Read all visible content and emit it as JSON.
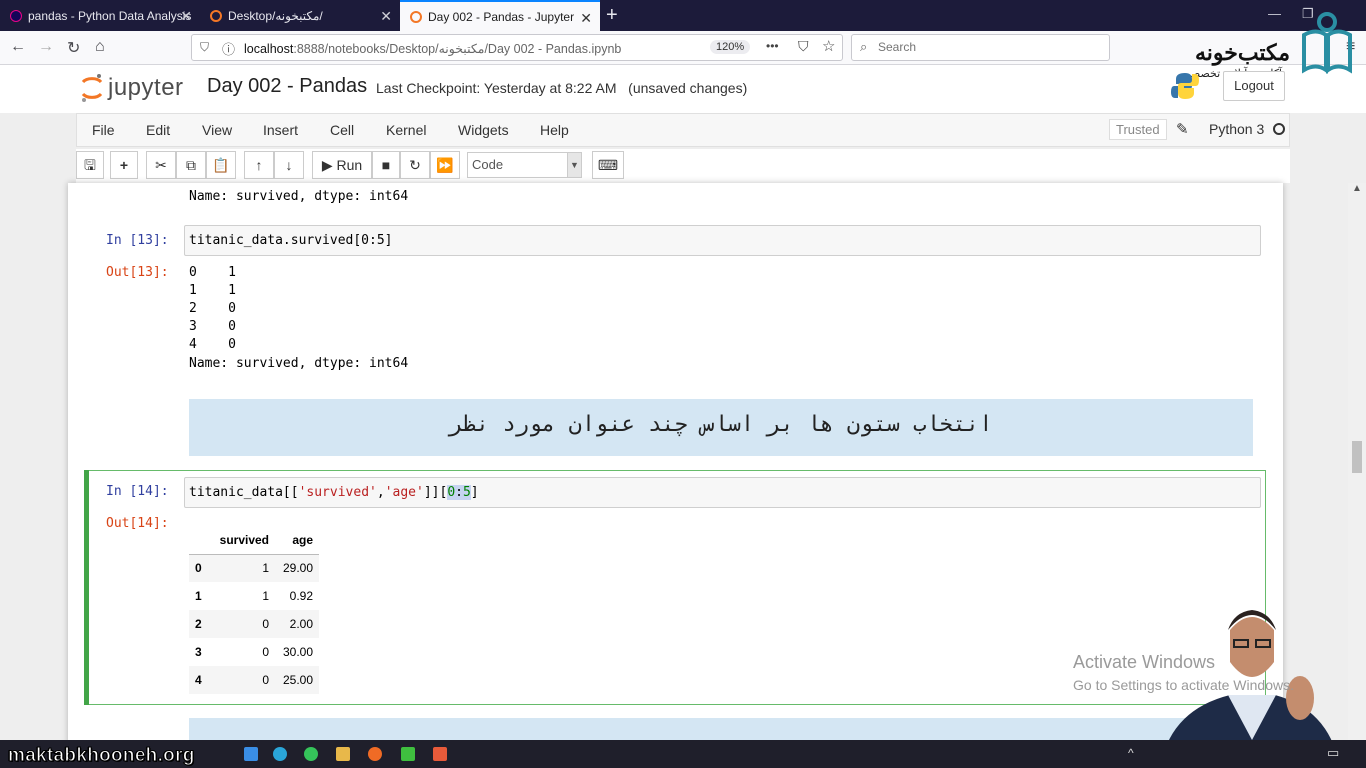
{
  "browser": {
    "tabs": [
      {
        "title": "pandas - Python Data Analysis"
      },
      {
        "title": "Desktop/مکتبخونه/"
      },
      {
        "title": "Day 002 - Pandas - Jupyter Not"
      }
    ],
    "url_host": "localhost",
    "url_path": ":8888/notebooks/Desktop/مکتبخونه/Day 002 - Pandas.ipynb",
    "zoom": "120%",
    "search_placeholder": "Search",
    "more_label": "•••"
  },
  "brand": {
    "name": "مکتب‌خونه",
    "tagline": "آکادمی آنلاین تخصصی ها"
  },
  "jupyter": {
    "logo": "jupyter",
    "title": "Day 002 - Pandas",
    "checkpoint": "Last Checkpoint: Yesterday at 8:22 AM",
    "unsaved": "(unsaved changes)",
    "logout": "Logout",
    "menu": [
      "File",
      "Edit",
      "View",
      "Insert",
      "Cell",
      "Kernel",
      "Widgets",
      "Help"
    ],
    "trusted": "Trusted",
    "kernel": "Python 3",
    "toolbar": {
      "run": "Run",
      "cell_type": "Code"
    }
  },
  "cells": {
    "prev_output_tail": "Name: survived, dtype: int64",
    "cell13": {
      "in_prompt": "In [13]:",
      "code": "titanic_data.survived[0:5]",
      "out_prompt": "Out[13]:",
      "output_lines": [
        "0    1",
        "1    1",
        "2    0",
        "3    0",
        "4    0",
        "Name: survived, dtype: int64"
      ]
    },
    "markdown1": "انتخاب ستون ها بر اساس چند عنوان مورد نظر",
    "cell14": {
      "in_prompt": "In [14]:",
      "code_prefix": "titanic_data[[",
      "code_str1": "'survived'",
      "code_comma": ",",
      "code_str2": "'age'",
      "code_mid": "]][",
      "code_num1": "0",
      "code_colon": ":",
      "code_num2": "5",
      "code_end": "]",
      "out_prompt": "Out[14]:",
      "table": {
        "columns": [
          "",
          "survived",
          "age"
        ],
        "rows": [
          [
            "0",
            "1",
            "29.00"
          ],
          [
            "1",
            "1",
            "0.92"
          ],
          [
            "2",
            "0",
            "2.00"
          ],
          [
            "3",
            "0",
            "30.00"
          ],
          [
            "4",
            "0",
            "25.00"
          ]
        ]
      }
    }
  },
  "watermark": {
    "line1": "Activate Windows",
    "line2": "Go to Settings to activate Windows."
  },
  "taskbar": {
    "site": "maktabkhooneh.org"
  }
}
